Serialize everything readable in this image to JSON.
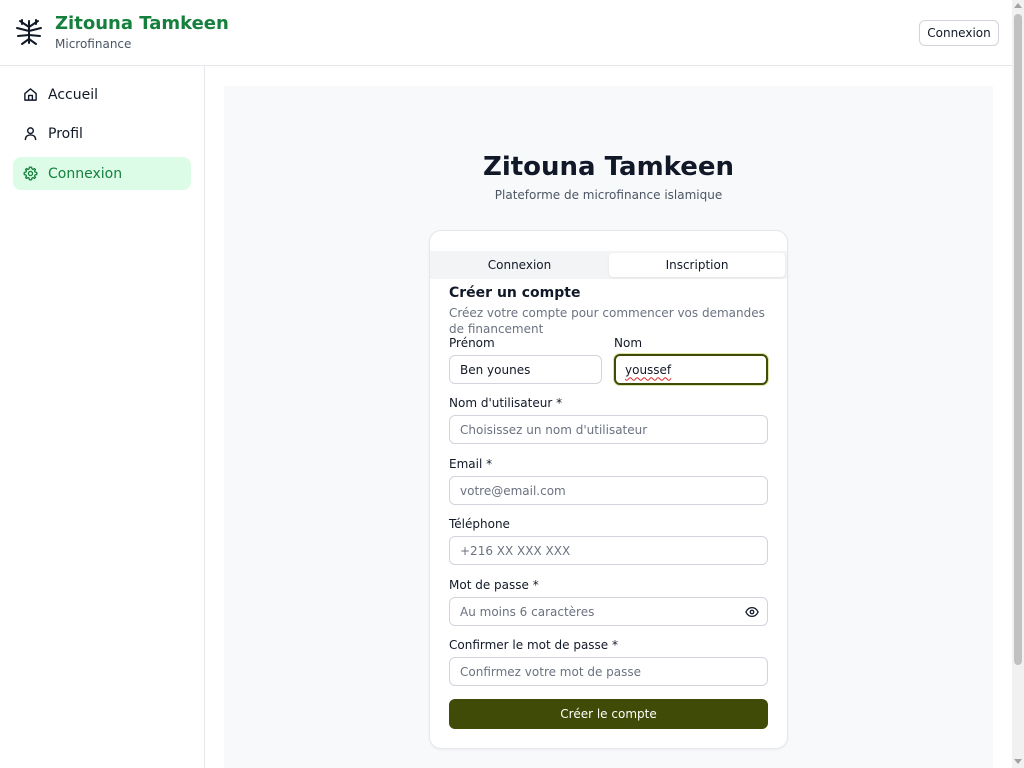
{
  "header": {
    "logo_icon": "tree-icon",
    "title": "Zitouna Tamkeen",
    "subtitle": "Microfinance",
    "login_button": "Connexion"
  },
  "sidebar": {
    "items": [
      {
        "label": "Accueil",
        "icon": "home-icon",
        "active": false
      },
      {
        "label": "Profil",
        "icon": "user-icon",
        "active": false
      },
      {
        "label": "Connexion",
        "icon": "gear-icon",
        "active": true
      }
    ]
  },
  "main": {
    "title": "Zitouna Tamkeen",
    "subtitle": "Plateforme de microfinance islamique",
    "tabs": [
      {
        "label": "Connexion",
        "selected": false
      },
      {
        "label": "Inscription",
        "selected": true
      }
    ],
    "form": {
      "title": "Créer un compte",
      "description": "Créez votre compte pour commencer vos demandes de financement",
      "first_name": {
        "label": "Prénom",
        "value": "Ben younes"
      },
      "last_name": {
        "label": "Nom",
        "value": "youssef"
      },
      "username": {
        "label": "Nom d'utilisateur *",
        "placeholder": "Choisissez un nom d'utilisateur"
      },
      "email": {
        "label": "Email *",
        "placeholder": "votre@email.com"
      },
      "phone": {
        "label": "Téléphone",
        "placeholder": "+216 XX XXX XXX"
      },
      "password": {
        "label": "Mot de passe *",
        "placeholder": "Au moins 6 caractères",
        "toggle_icon": "eye-icon"
      },
      "confirm_password": {
        "label": "Confirmer le mot de passe *",
        "placeholder": "Confirmez votre mot de passe"
      },
      "submit_label": "Créer le compte"
    }
  },
  "colors": {
    "brand_green": "#15803d",
    "active_nav_bg": "#dcfce7",
    "submit_bg": "#3f4b06"
  }
}
